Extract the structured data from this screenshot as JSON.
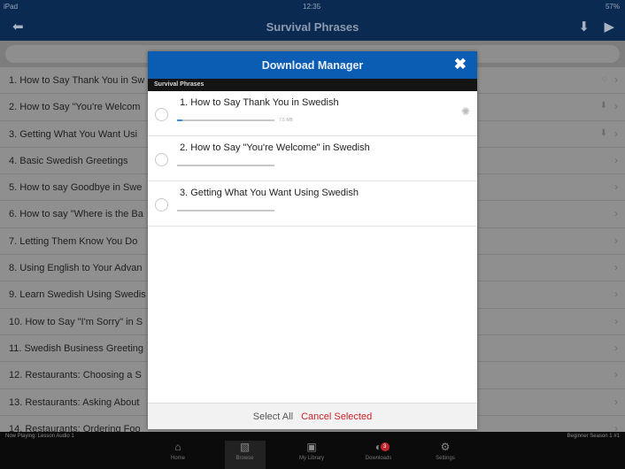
{
  "status": {
    "device": "iPad",
    "time": "12:35",
    "battery": "57%"
  },
  "nav": {
    "title": "Survival Phrases"
  },
  "list": [
    "1. How to Say Thank You in Sw",
    "2. How to Say \"You're Welcom",
    "3. Getting What You Want Usi",
    "4. Basic Swedish Greetings",
    "5. How to say Goodbye in Swe",
    "6. How to say \"Where is the Ba",
    "7. Letting Them Know You Do",
    "8. Using English to Your Advan",
    "9. Learn Swedish Using Swedis",
    "10. How to Say \"I'm Sorry\" in S",
    "11. Swedish Business Greeting",
    "12. Restaurants: Choosing a S",
    "13. Restaurants: Asking About",
    "14. Restaurants: Ordering Foo"
  ],
  "modal": {
    "title": "Download Manager",
    "section": "Survival Phrases",
    "items": [
      {
        "title": "1. How to Say Thank You in Swedish",
        "progress": 0.05,
        "size": "7.5 MB",
        "downloading": true
      },
      {
        "title": "2. How to Say \"You're Welcome\" in Swedish",
        "progress": 0
      },
      {
        "title": "3. Getting What You Want Using Swedish",
        "progress": 0
      }
    ],
    "select_all": "Select All",
    "cancel_selected": "Cancel Selected"
  },
  "player": {
    "now_playing": "Now Playing: Lesson Audio 1",
    "season": "Beginner Season 1 #1"
  },
  "tabs": [
    {
      "label": "Home",
      "icon": "home-icon"
    },
    {
      "label": "Browse",
      "icon": "browse-icon",
      "active": true
    },
    {
      "label": "My Library",
      "icon": "library-icon"
    },
    {
      "label": "Downloads",
      "icon": "downloads-icon",
      "badge": "3"
    },
    {
      "label": "Settings",
      "icon": "gear-icon"
    }
  ],
  "colors": {
    "nav": "#0a2a52",
    "modal_header": "#0a5db3",
    "cancel": "#c8242c"
  }
}
